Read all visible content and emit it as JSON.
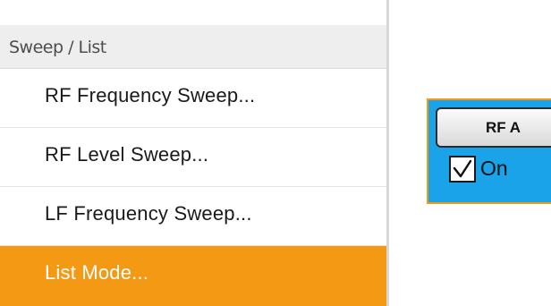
{
  "menu": {
    "header": "Sweep / List",
    "items": [
      {
        "label": "RF Frequency Sweep...",
        "selected": false
      },
      {
        "label": "RF Level Sweep...",
        "selected": false
      },
      {
        "label": "LF Frequency Sweep...",
        "selected": false
      },
      {
        "label": "List Mode...",
        "selected": true
      }
    ]
  },
  "rf_block": {
    "button_label": "RF A",
    "checkbox_label": "On",
    "checked": true
  },
  "colors": {
    "accent_orange": "#f39914",
    "rf_blue": "#1aa3e8",
    "header_gray": "#eeeeee"
  },
  "icons": {
    "checkmark": "checkmark-icon"
  }
}
